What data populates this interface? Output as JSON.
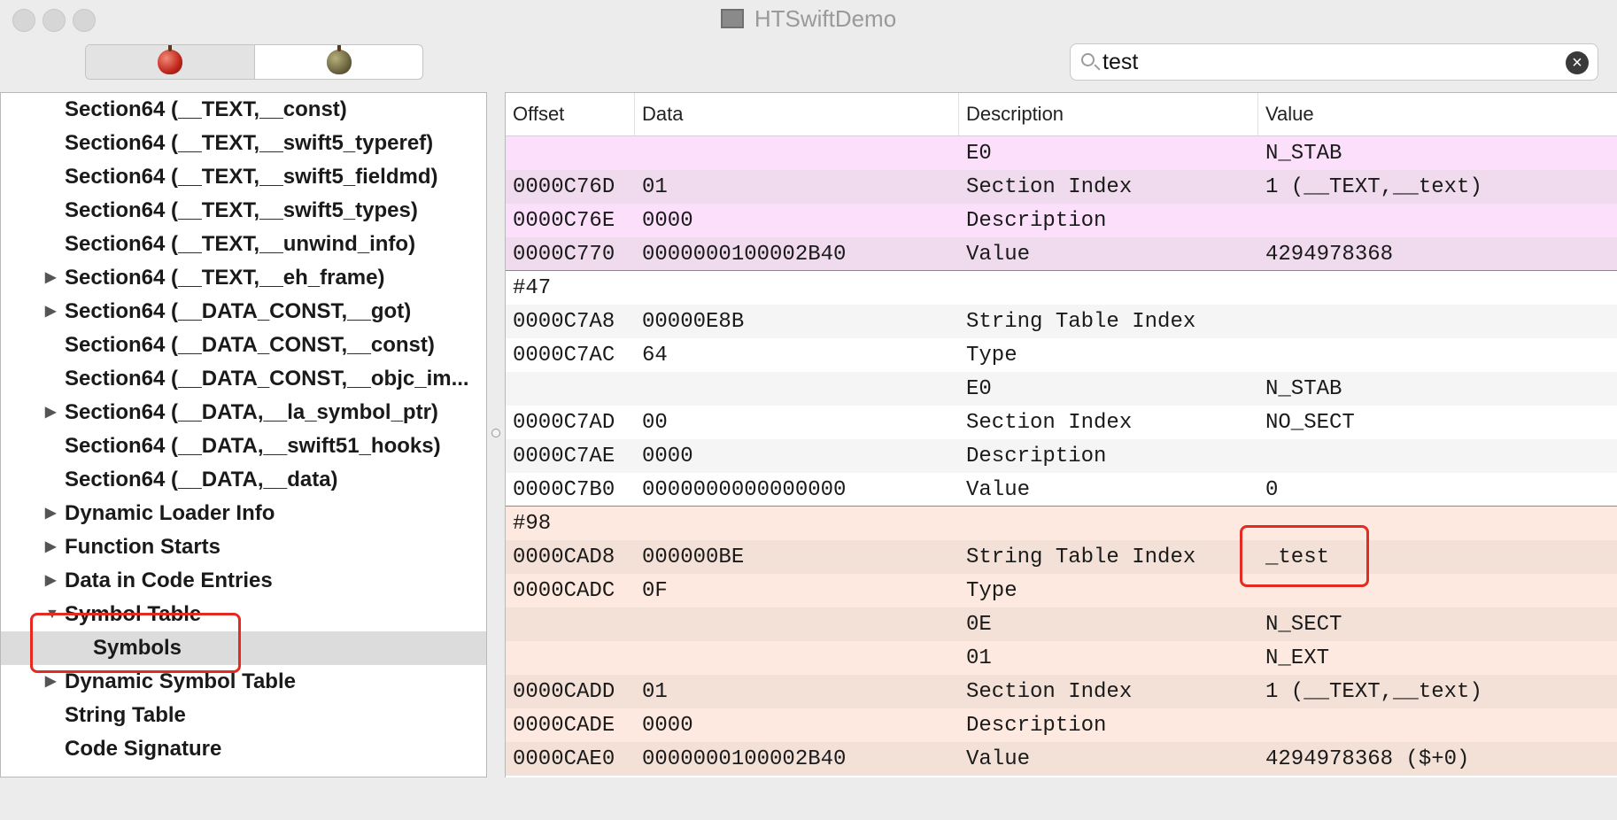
{
  "window": {
    "title": "HTSwiftDemo"
  },
  "toolbar": {
    "segments": [
      {
        "icon": "red-apple-icon"
      },
      {
        "icon": "gray-apple-icon"
      }
    ]
  },
  "search": {
    "value": "test"
  },
  "outline": {
    "items": [
      {
        "label": "Section64 (__TEXT,__const)",
        "expandable": false
      },
      {
        "label": "Section64 (__TEXT,__swift5_typeref)",
        "expandable": false
      },
      {
        "label": "Section64 (__TEXT,__swift5_fieldmd)",
        "expandable": false
      },
      {
        "label": "Section64 (__TEXT,__swift5_types)",
        "expandable": false
      },
      {
        "label": "Section64 (__TEXT,__unwind_info)",
        "expandable": false
      },
      {
        "label": "Section64 (__TEXT,__eh_frame)",
        "expandable": true
      },
      {
        "label": "Section64 (__DATA_CONST,__got)",
        "expandable": true
      },
      {
        "label": "Section64 (__DATA_CONST,__const)",
        "expandable": false
      },
      {
        "label": "Section64 (__DATA_CONST,__objc_im...",
        "expandable": false
      },
      {
        "label": "Section64 (__DATA,__la_symbol_ptr)",
        "expandable": true
      },
      {
        "label": "Section64 (__DATA,__swift51_hooks)",
        "expandable": false
      },
      {
        "label": "Section64 (__DATA,__data)",
        "expandable": false
      },
      {
        "label": "Dynamic Loader Info",
        "expandable": true
      },
      {
        "label": "Function Starts",
        "expandable": true
      },
      {
        "label": "Data in Code Entries",
        "expandable": true
      },
      {
        "label": "Symbol Table",
        "expandable": true,
        "expanded": true
      },
      {
        "label": "Symbols",
        "expandable": false,
        "child": true,
        "selected": true
      },
      {
        "label": "Dynamic Symbol Table",
        "expandable": true
      },
      {
        "label": "String Table",
        "expandable": false
      },
      {
        "label": "Code Signature",
        "expandable": false
      }
    ]
  },
  "table": {
    "columns": [
      "Offset",
      "Data",
      "Description",
      "Value"
    ],
    "rows": [
      {
        "group": "pink",
        "cells": [
          "",
          "",
          "E0",
          "N_STAB"
        ]
      },
      {
        "group": "pink",
        "cells": [
          "0000C76D",
          "01",
          "Section Index",
          "1 (__TEXT,__text)"
        ]
      },
      {
        "group": "pink",
        "cells": [
          "0000C76E",
          "0000",
          "Description",
          ""
        ]
      },
      {
        "group": "pink",
        "cells": [
          "0000C770",
          "0000000100002B40",
          "Value",
          "4294978368"
        ]
      },
      {
        "group": "white",
        "cells": [
          "#47",
          "",
          "",
          ""
        ]
      },
      {
        "group": "white",
        "cells": [
          "0000C7A8",
          "00000E8B",
          "String Table Index",
          ""
        ]
      },
      {
        "group": "white",
        "cells": [
          "0000C7AC",
          "64",
          "Type",
          ""
        ]
      },
      {
        "group": "white",
        "cells": [
          "",
          "",
          "E0",
          "N_STAB"
        ]
      },
      {
        "group": "white",
        "cells": [
          "0000C7AD",
          "00",
          "Section Index",
          "NO_SECT"
        ]
      },
      {
        "group": "white",
        "cells": [
          "0000C7AE",
          "0000",
          "Description",
          ""
        ]
      },
      {
        "group": "white",
        "cells": [
          "0000C7B0",
          "0000000000000000",
          "Value",
          "0"
        ]
      },
      {
        "group": "orange",
        "cells": [
          "#98",
          "",
          "",
          ""
        ]
      },
      {
        "group": "orange",
        "cells": [
          "0000CAD8",
          "000000BE",
          "String Table Index",
          "_test"
        ]
      },
      {
        "group": "orange",
        "cells": [
          "0000CADC",
          "0F",
          "Type",
          ""
        ]
      },
      {
        "group": "orange",
        "cells": [
          "",
          "",
          "0E",
          "N_SECT"
        ]
      },
      {
        "group": "orange",
        "cells": [
          "",
          "",
          "01",
          "N_EXT"
        ]
      },
      {
        "group": "orange",
        "cells": [
          "0000CADD",
          "01",
          "Section Index",
          "1 (__TEXT,__text)"
        ]
      },
      {
        "group": "orange",
        "cells": [
          "0000CADE",
          "0000",
          "Description",
          ""
        ]
      },
      {
        "group": "orange",
        "cells": [
          "0000CAE0",
          "0000000100002B40",
          "Value",
          "4294978368 ($+0)"
        ]
      }
    ]
  },
  "colors": {
    "highlight": "#e52a20",
    "pink": "#fce0fb",
    "orange": "#fde9df"
  }
}
